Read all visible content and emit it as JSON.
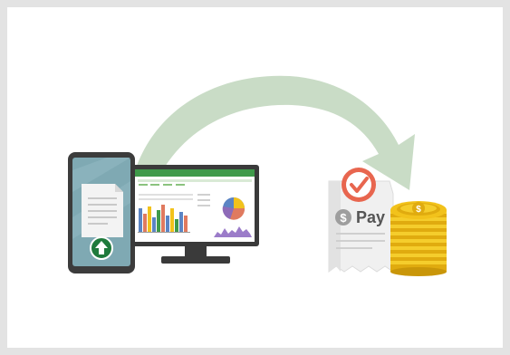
{
  "illustration": {
    "receipt": {
      "pay_label": "Pay",
      "currency_symbol": "$"
    },
    "coin_symbol": "$",
    "colors": {
      "arrow": "#c9dcc6",
      "phone_body": "#3c3c3c",
      "phone_screen": "#7fa9b3",
      "upload_button": "#1f7a3c",
      "spreadsheet_header": "#3f9a4a",
      "checkmark_badge": "#e8664f",
      "coins": "#f2c21b",
      "receipt": "#f0f0f0"
    },
    "icons": [
      "upload-icon",
      "checkmark-icon",
      "dollar-icon",
      "spreadsheet-icon",
      "document-icon"
    ]
  }
}
